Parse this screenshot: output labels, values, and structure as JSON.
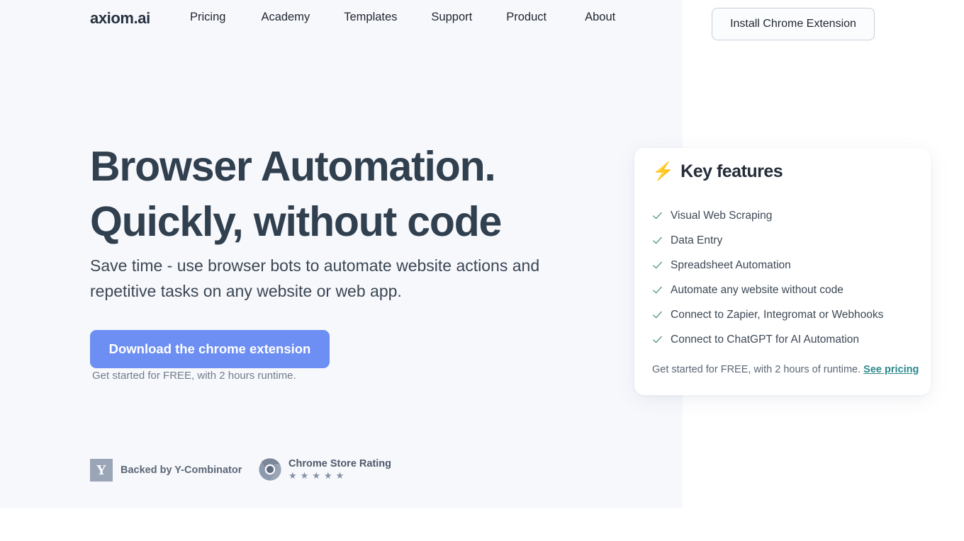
{
  "nav": {
    "brand": "axiom.ai",
    "links": [
      {
        "label": "Pricing"
      },
      {
        "label": "Academy"
      },
      {
        "label": "Templates"
      },
      {
        "label": "Support"
      },
      {
        "label": "Product"
      },
      {
        "label": "About"
      }
    ],
    "install_button": "Install Chrome Extension"
  },
  "hero": {
    "headline": "Browser Automation. Quickly, without code",
    "subcopy": "Save time - use browser bots to automate website actions and repetitive tasks on any website or web app.",
    "cta_button": "Download the chrome extension",
    "cta_note": "Get started for FREE, with 2 hours runtime."
  },
  "features": {
    "bolt_icon": "lightning-bolt-icon",
    "title": "Key features",
    "items": [
      {
        "label": "Visual Web Scraping"
      },
      {
        "label": "Data Entry"
      },
      {
        "label": "Spreadsheet Automation"
      },
      {
        "label": "Automate any website without code"
      },
      {
        "label": "Connect to Zapier, Integromat or Webhooks"
      },
      {
        "label": "Connect to ChatGPT for AI Automation"
      }
    ],
    "footnote_text": "Get started for FREE, with 2 hours of runtime. ",
    "footnote_link": "See pricing"
  },
  "badges": {
    "yc_mark": "Y",
    "yc_text": "Backed by Y-Combinator",
    "chrome_title": "Chrome Store Rating",
    "chrome_stars": [
      "★",
      "★",
      "★",
      "★",
      "★"
    ]
  },
  "colors": {
    "hero_bg": "#F7F8FC",
    "cta_blue": "#6D8EF2",
    "check_green": "#5D9E84",
    "bolt_yellow": "#F2C12E",
    "link_teal": "#2B8A8C",
    "heading_slate": "#31404F"
  }
}
